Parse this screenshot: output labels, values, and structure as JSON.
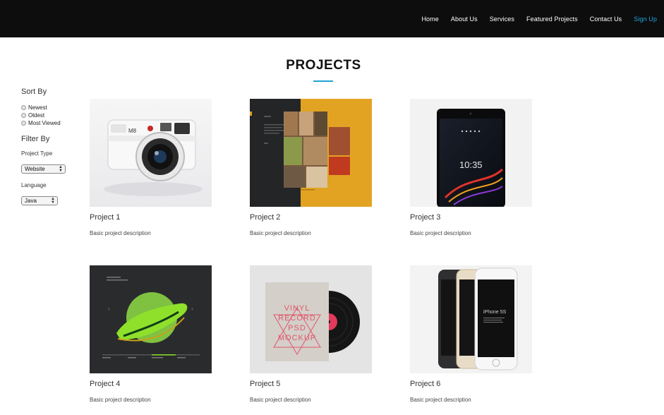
{
  "nav": {
    "items": [
      "Home",
      "About Us",
      "Services",
      "Featured Projects",
      "Contact Us"
    ],
    "signup": "Sign Up",
    "accent_color": "#1fa3d8"
  },
  "page": {
    "title": "PROJECTS"
  },
  "sidebar": {
    "sort_heading": "Sort By",
    "sort_options": [
      "Newest",
      "Oldest",
      "Most Viewed"
    ],
    "filter_heading": "Filter By",
    "project_type_label": "Project Type",
    "project_type_value": "Website",
    "language_label": "Language",
    "language_value": "Java"
  },
  "projects": [
    {
      "title": "Project 1",
      "description": "Basic project description",
      "image": "camera"
    },
    {
      "title": "Project 2",
      "description": "Basic project description",
      "image": "restaurant-website"
    },
    {
      "title": "Project 3",
      "description": "Basic project description",
      "image": "smartphone"
    },
    {
      "title": "Project 4",
      "description": "Basic project description",
      "image": "sneaker"
    },
    {
      "title": "Project 5",
      "description": "Basic project description",
      "image": "vinyl-record-mockup"
    },
    {
      "title": "Project 6",
      "description": "Basic project description",
      "image": "iphones"
    }
  ],
  "thumb_text": {
    "camera_model": "M8",
    "phone_time": "10:35",
    "vinyl_lines": [
      "VINYL",
      "RECORD",
      "PSD",
      "MOCKUP"
    ],
    "iphone_label": "iPhone 5S"
  }
}
